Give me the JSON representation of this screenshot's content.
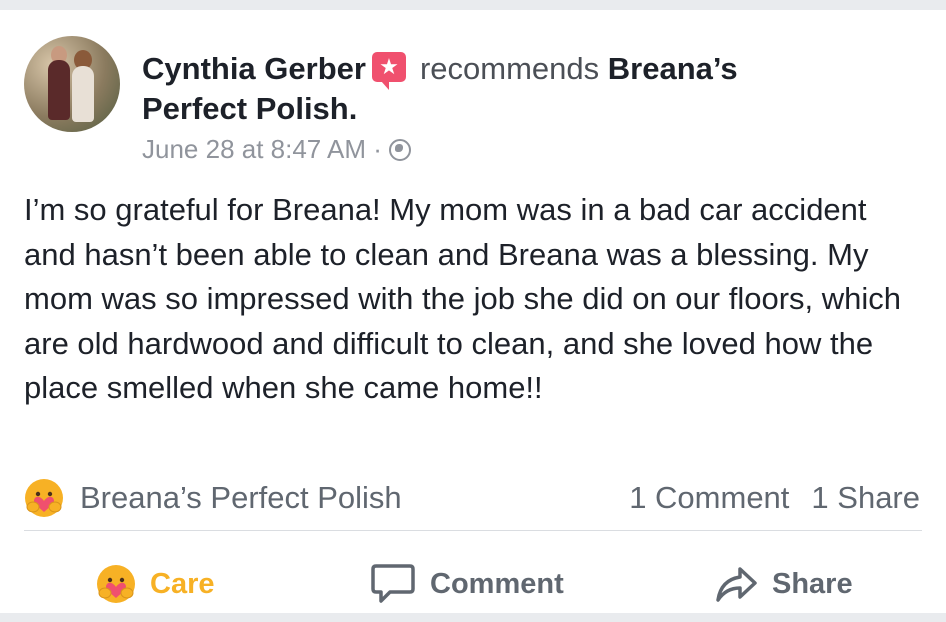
{
  "post": {
    "author": "Cynthia Gerber",
    "action_text": "recommends",
    "page_name": "Breana’s Perfect Polish.",
    "timestamp": "June 28 at 8:47 AM",
    "separator": "·",
    "privacy_icon": "globe-icon",
    "recommend_icon": "recommend-star-icon",
    "body": "I’m so grateful for Breana! My mom was in a bad car accident and hasn’t been able to clean and Breana was a blessing. My mom was so impressed with the job she did on our floors, which are old hardwood and difficult to clean, and she loved how the place smelled when she came home!!"
  },
  "stats": {
    "reaction_icon": "care-emoji-icon",
    "reactor": "Breana’s Perfect Polish",
    "comments": "1 Comment",
    "shares": "1 Share"
  },
  "actions": {
    "care": "Care",
    "comment": "Comment",
    "share": "Share"
  },
  "colors": {
    "care_accent": "#f7b125",
    "recommend_badge": "#f0506e",
    "text_primary": "#1d2129",
    "text_secondary": "#606770"
  }
}
